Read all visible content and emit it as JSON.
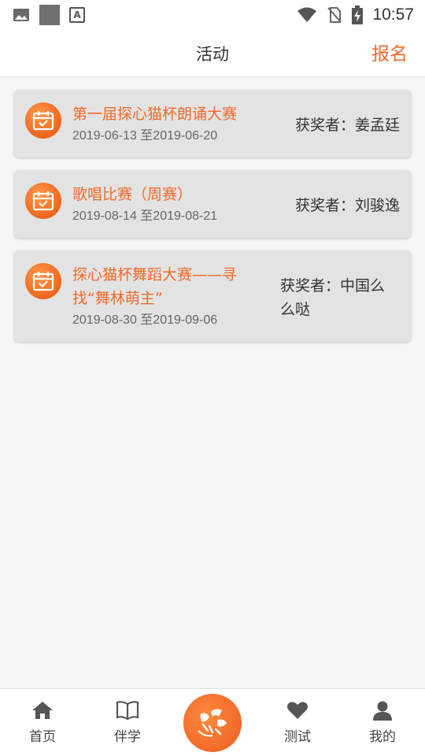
{
  "status_bar": {
    "time": "10:57",
    "icons": [
      "image-icon",
      "square-icon",
      "a-icon",
      "wifi-icon",
      "no-sim-icon",
      "battery-charging-icon"
    ]
  },
  "header": {
    "title": "活动",
    "action_label": "报名"
  },
  "activities": [
    {
      "title": "第一届探心猫杯朗诵大赛",
      "date_range": "2019-06-13 至2019-06-20",
      "winner_label": "获奖者：",
      "winner_name": "姜孟廷",
      "icon": "calendar-check-icon"
    },
    {
      "title": "歌唱比赛（周赛）",
      "date_range": "2019-08-14 至2019-08-21",
      "winner_label": "获奖者：",
      "winner_name": "刘骏逸",
      "icon": "calendar-check-icon"
    },
    {
      "title": "探心猫杯舞蹈大赛——寻找“舞林萌主”",
      "date_range": "2019-08-30 至2019-09-06",
      "winner_label": "获奖者：",
      "winner_name": "中国么么哒",
      "icon": "calendar-check-icon"
    }
  ],
  "colors": {
    "accent": "#f06a2a",
    "card_bg": "#e3e3e3",
    "page_bg": "#f6f6f6"
  },
  "bottom_nav": {
    "items": [
      {
        "label": "首页",
        "icon": "home-icon"
      },
      {
        "label": "伴学",
        "icon": "book-icon"
      },
      {
        "label": "",
        "icon": "center-logo"
      },
      {
        "label": "测试",
        "icon": "heart-icon"
      },
      {
        "label": "我的",
        "icon": "user-icon"
      }
    ]
  }
}
